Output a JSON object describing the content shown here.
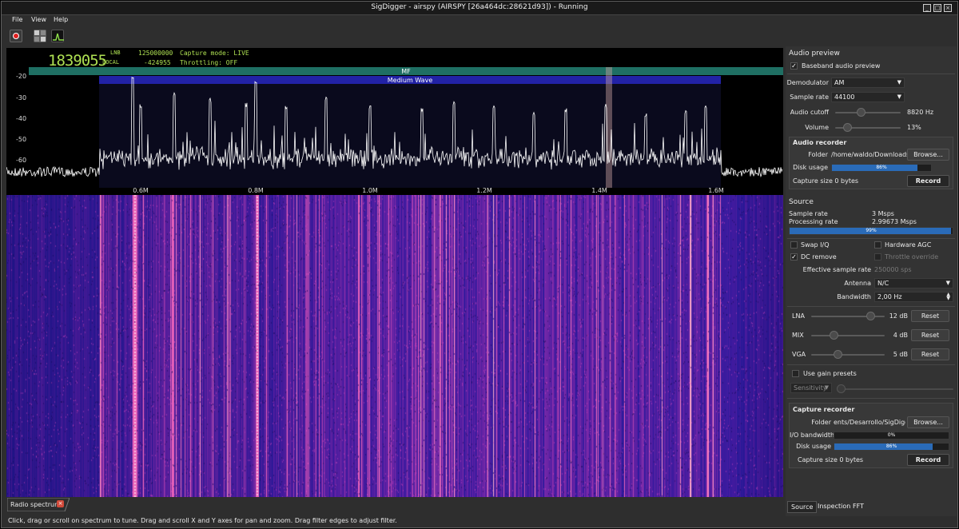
{
  "window": {
    "title": "SigDigger - airspy (AIRSPY [26a464dc:28621d93]) - Running"
  },
  "menu": {
    "items": [
      "File",
      "View",
      "Help"
    ]
  },
  "toolbar": {
    "icons": [
      "record-icon",
      "settings-icon",
      "spectrum-icon"
    ]
  },
  "display": {
    "frequency": "1839055",
    "lnb_label": "LNB",
    "lnb_value": "125000000",
    "local_label": "LOCAL",
    "local_value": "-424955",
    "capture_mode": "Capture mode: LIVE",
    "throttling": "Throttling: OFF"
  },
  "bands": {
    "outer": "MF",
    "inner": "Medium Wave"
  },
  "spectrum": {
    "y_ticks": [
      "-20",
      "-30",
      "-40",
      "-50",
      "-60"
    ],
    "x_ticks": [
      "0.6M",
      "0.8M",
      "1.0M",
      "1.2M",
      "1.4M",
      "1.6M"
    ],
    "colors": {
      "band_outer": "#1f6f63",
      "band_inner": "#2222a6",
      "trace": "#ffffff",
      "filter": "#c8a0a0"
    }
  },
  "audio_preview": {
    "heading": "Audio preview",
    "baseband_label": "Baseband audio preview",
    "baseband_checked": true,
    "demodulator_label": "Demodulator",
    "demodulator_value": "AM",
    "sample_rate_label": "Sample rate",
    "sample_rate_value": "44100",
    "cutoff_label": "Audio cutoff",
    "cutoff_value": "8820 Hz",
    "cutoff_level": 0.35,
    "volume_label": "Volume",
    "volume_value": "13%",
    "volume_level": 0.13
  },
  "audio_recorder": {
    "heading": "Audio recorder",
    "folder_label": "Folder",
    "folder_value": "/home/waldo/Downloads",
    "browse": "Browse...",
    "disk_label": "Disk usage",
    "disk_value": "86%",
    "disk_level": 0.86,
    "capture_size": "Capture size 0 bytes",
    "record": "Record"
  },
  "source": {
    "heading": "Source",
    "sample_rate_label": "Sample rate",
    "sample_rate_value": "3 Msps",
    "processing_label": "Processing rate",
    "processing_value": "2.99673 Msps",
    "processing_bar": "99%",
    "processing_level": 0.99,
    "swap_iq": "Swap I/Q",
    "hardware_agc": "Hardware AGC",
    "dc_remove": "DC remove",
    "throttle_override": "Throttle override",
    "effective_label": "Effective sample rate",
    "effective_value": "250000 sps",
    "antenna_label": "Antenna",
    "antenna_value": "N/C",
    "bandwidth_label": "Bandwidth",
    "bandwidth_value": "2,00 Hz"
  },
  "gains": [
    {
      "label": "LNA",
      "value": "12 dB",
      "reset": "Reset",
      "level": 0.8
    },
    {
      "label": "MIX",
      "value": "4 dB",
      "reset": "Reset",
      "level": 0.27
    },
    {
      "label": "VGA",
      "value": "5 dB",
      "reset": "Reset",
      "level": 0.33
    }
  ],
  "gain_presets": {
    "label": "Use gain presets",
    "preset_value": "Sensitivity"
  },
  "capture_recorder": {
    "heading": "Capture recorder",
    "folder_label": "Folder",
    "folder_value": "ents/Desarrollo/SigDigger",
    "browse": "Browse...",
    "io_label": "I/O bandwidth",
    "io_value": "0%",
    "io_level": 0.0,
    "disk_label": "Disk usage",
    "disk_value": "86%",
    "disk_level": 0.86,
    "capture_size": "Capture size 0 bytes",
    "record": "Record"
  },
  "panel_tabs": [
    "Source",
    "Inspection",
    "FFT"
  ],
  "spectrum_tab": "Radio spectrum",
  "status": "Click, drag or scroll on spectrum to tune. Drag and scroll X and Y axes for pan and zoom. Drag filter edges to adjust filter."
}
